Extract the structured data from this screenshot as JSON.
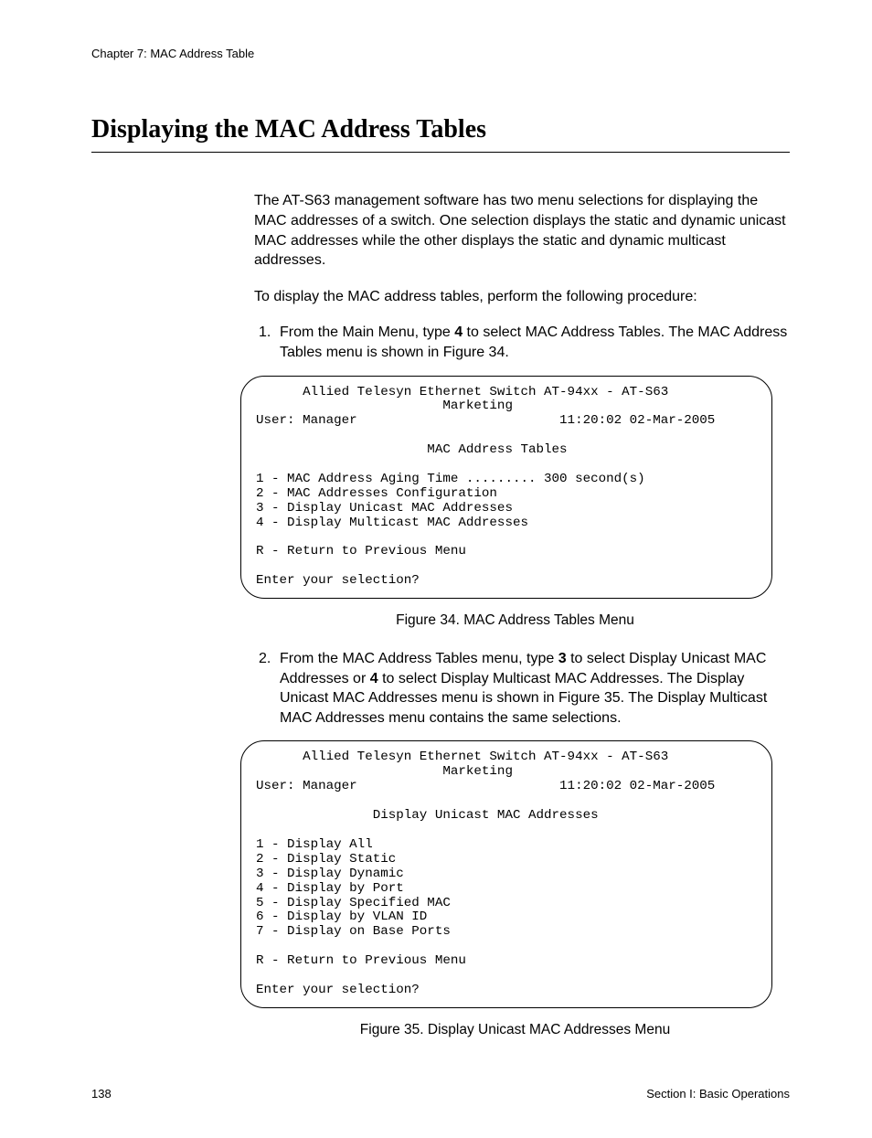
{
  "chapter_header": "Chapter 7: MAC Address Table",
  "heading": "Displaying the MAC Address Tables",
  "intro_para": "The AT-S63 management software has two menu selections for displaying the MAC addresses of a switch. One selection displays the static and dynamic unicast MAC addresses while the other displays the static and dynamic multicast addresses.",
  "lead_para": "To display the MAC address tables, perform the following procedure:",
  "step1_pre": "From the Main Menu, type ",
  "step1_bold": "4",
  "step1_post": " to select MAC Address Tables. The MAC Address Tables menu is shown in Figure 34.",
  "terminal1": {
    "title_line": "      Allied Telesyn Ethernet Switch AT-94xx - AT-S63",
    "sub_line": "                        Marketing",
    "user_line": "User: Manager                          11:20:02 02-Mar-2005",
    "menu_title": "                      MAC Address Tables",
    "opt1": "1 - MAC Address Aging Time ......... 300 second(s)",
    "opt2": "2 - MAC Addresses Configuration",
    "opt3": "3 - Display Unicast MAC Addresses",
    "opt4": "4 - Display Multicast MAC Addresses",
    "ret": "R - Return to Previous Menu",
    "prompt": "Enter your selection?"
  },
  "figcap1": "Figure 34. MAC Address Tables Menu",
  "step2_pre": "From the MAC Address Tables menu, type ",
  "step2_b1": "3",
  "step2_mid1": " to select Display Unicast MAC Addresses or ",
  "step2_b2": "4",
  "step2_post": " to select Display Multicast MAC Addresses. The Display Unicast MAC Addresses menu is shown in Figure 35. The Display Multicast MAC Addresses menu contains the same selections.",
  "terminal2": {
    "title_line": "      Allied Telesyn Ethernet Switch AT-94xx - AT-S63",
    "sub_line": "                        Marketing",
    "user_line": "User: Manager                          11:20:02 02-Mar-2005",
    "menu_title": "               Display Unicast MAC Addresses",
    "opt1": "1 - Display All",
    "opt2": "2 - Display Static",
    "opt3": "3 - Display Dynamic",
    "opt4": "4 - Display by Port",
    "opt5": "5 - Display Specified MAC",
    "opt6": "6 - Display by VLAN ID",
    "opt7": "7 - Display on Base Ports",
    "ret": "R - Return to Previous Menu",
    "prompt": "Enter your selection?"
  },
  "figcap2": "Figure 35. Display Unicast MAC Addresses Menu",
  "page_number": "138",
  "section_label": "Section I: Basic Operations"
}
